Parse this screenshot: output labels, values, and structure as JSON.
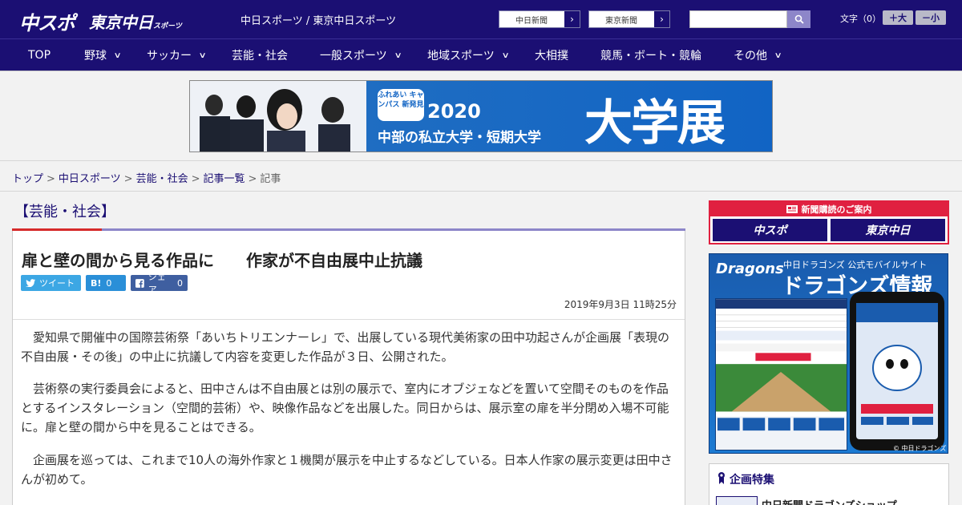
{
  "header": {
    "logo_primary": "中スポ",
    "logo_secondary": "東京中日",
    "logo_secondary_small": "スポーツ",
    "site_name": "中日スポーツ / 東京中日スポーツ",
    "external_links": [
      {
        "label": "中日新聞"
      },
      {
        "label": "東京新聞"
      }
    ],
    "search": {
      "placeholder": "",
      "value": ""
    },
    "font_size": {
      "label": "文字（0）",
      "plus": "＋大",
      "minus": "－小"
    }
  },
  "nav": {
    "items": [
      {
        "label": "TOP",
        "chevron": false
      },
      {
        "label": "野球",
        "chevron": true
      },
      {
        "label": "サッカー",
        "chevron": true
      },
      {
        "label": "芸能・社会",
        "chevron": false
      },
      {
        "label": "一般スポーツ",
        "chevron": true
      },
      {
        "label": "地域スポーツ",
        "chevron": true
      },
      {
        "label": "大相撲",
        "chevron": false
      },
      {
        "label": "競馬・ボート・競輪",
        "chevron": false
      },
      {
        "label": "その他",
        "chevron": true
      }
    ]
  },
  "banner": {
    "badge": "ふれあい キャンパス 新発見",
    "year": "2020",
    "subtitle": "中部の私立大学・短期大学",
    "big": "大学展"
  },
  "breadcrumb": {
    "items": [
      "トップ",
      "中日スポーツ",
      "芸能・社会",
      "記事一覧"
    ],
    "current": "記事"
  },
  "article": {
    "section": "【芸能・社会】",
    "headline": "扉と壁の間から見る作品に　　作家が不自由展中止抗議",
    "share": {
      "twitter": "ツイート",
      "hatena_icon": "B!",
      "hatena_count": "0",
      "facebook": "シェア",
      "facebook_count": "0"
    },
    "date": "2019年9月3日 11時25分",
    "paragraphs": [
      "　愛知県で開催中の国際芸術祭「あいちトリエンナーレ」で、出展している現代美術家の田中功起さんが企画展「表現の不自由展・その後」の中止に抗議して内容を変更した作品が３日、公開された。",
      "　芸術祭の実行委員会によると、田中さんは不自由展とは別の展示で、室内にオブジェなどを置いて空間そのものを作品とするインスタレーション（空間的芸術）や、映像作品などを出展した。同日からは、展示室の扉を半分閉め入場不可能に。扉と壁の間から中を見ることはできる。",
      "　企画展を巡っては、これまで10人の海外作家と１機関が展示を中止するなどしている。日本人作家の展示変更は田中さんが初めて。"
    ]
  },
  "sidebar": {
    "subscription": {
      "title": "新聞購読のご案内",
      "logos": [
        "中スポ",
        "東京中日"
      ]
    },
    "dragons_ad": {
      "logo": "Dragons",
      "subtitle": "中日ドラゴンズ 公式モバイルサイト",
      "title": "ドラゴンズ情報",
      "copyright": "© 中日ドラゴンズ"
    },
    "feature": {
      "title": "企画特集",
      "first_item": "中日新聞ドラゴンズショップ"
    }
  },
  "colors": {
    "brand_navy": "#1b0f73",
    "accent_red": "#e02040",
    "accent_lavender": "#8d86c9"
  }
}
